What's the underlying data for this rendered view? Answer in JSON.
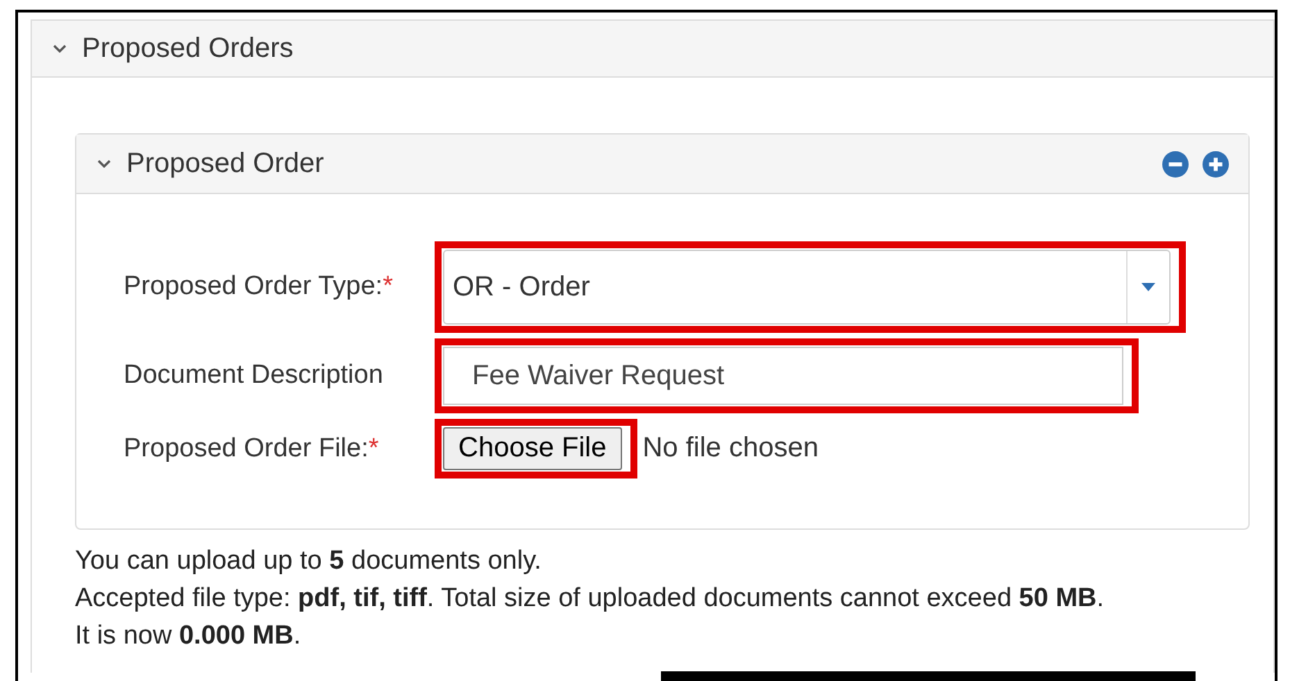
{
  "section": {
    "title": "Proposed Orders",
    "expanded": true
  },
  "panel": {
    "title": "Proposed Order",
    "expanded": true
  },
  "fields": [
    {
      "kind": "select",
      "label": "Proposed Order Type:",
      "required_mark": "*",
      "value": "OR - Order",
      "highlighted": true
    },
    {
      "kind": "text",
      "label": "Document Description",
      "value": "Fee Waiver Request",
      "highlighted": true
    },
    {
      "kind": "file",
      "label": "Proposed Order File:",
      "required_mark": "*",
      "button": "Choose File",
      "status": "No file chosen",
      "highlighted": true
    }
  ],
  "notes": [
    "You can upload up to **5** documents only.",
    "Accepted file type: **pdf, tif, tiff**. Total size of uploaded documents cannot exceed **50 MB**.",
    "It is now **0.000 MB**."
  ]
}
